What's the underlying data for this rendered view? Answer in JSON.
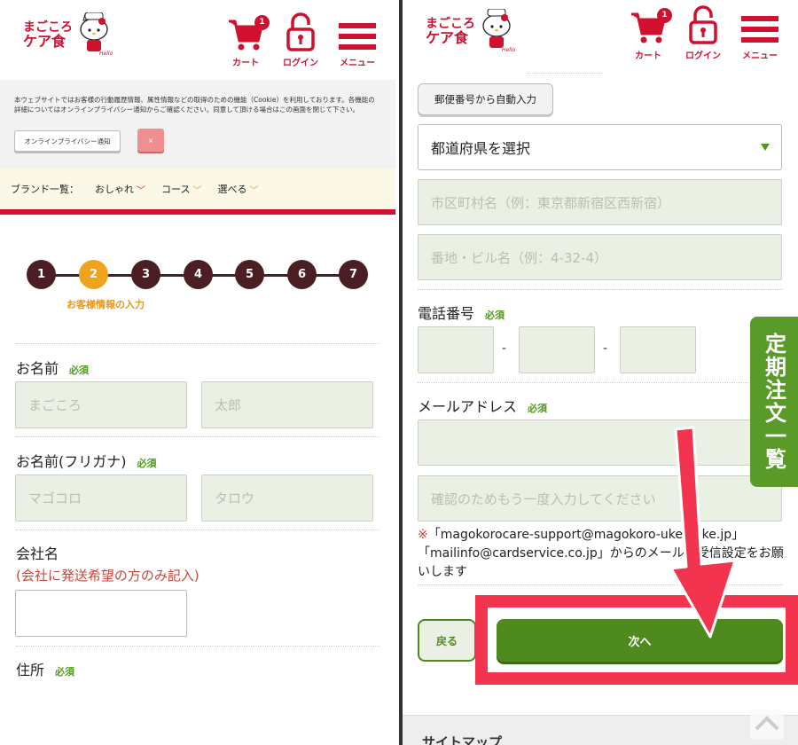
{
  "header": {
    "logo_line1": "まごころ",
    "logo_line2": "ケア食",
    "cart_label": "カート",
    "cart_count": "1",
    "login_label": "ログイン",
    "menu_label": "メニュー"
  },
  "cookie": {
    "text": "本ウェブサイトではお客様の行動履歴情報、属性情報などの取得のための機能（Cookie）を利用しております。各機能の詳細についてはオンラインプライバシー通知からご確認ください。同意して頂ける場合はこの画面を閉じて下さい。",
    "notice_button": "オンラインプライバシー通知",
    "close_button": "×"
  },
  "brand_nav": {
    "label": "ブランド一覧：",
    "items": [
      "おしゃれ",
      "コース",
      "選べる"
    ]
  },
  "steps": {
    "numbers": [
      "1",
      "2",
      "3",
      "4",
      "5",
      "6",
      "7"
    ],
    "active_index": 1,
    "caption": "お客様情報の入力"
  },
  "form_left": {
    "name_label": "お名前",
    "name_required": "必須",
    "last_name_placeholder": "まごころ",
    "first_name_placeholder": "太郎",
    "kana_label": "お名前(フリガナ)",
    "kana_required": "必須",
    "last_kana_placeholder": "マゴコロ",
    "first_kana_placeholder": "タロウ",
    "company_label": "会社名",
    "company_note": "(会社に発送希望の方のみ記入)",
    "address_label": "住所",
    "address_required": "必須"
  },
  "form_right": {
    "zip_button": "郵便番号から自動入力",
    "prefecture_select": "都道府県を選択",
    "city_placeholder": "市区町村名（例：東京都新宿区西新宿）",
    "street_placeholder": "番地・ビル名（例：4-32-4）",
    "phone_label": "電話番号",
    "phone_required": "必須",
    "phone_dash": "-",
    "email_label": "メールアドレス",
    "email_required": "必須",
    "email_confirm_placeholder": "確認のためもう一度入力してください",
    "mail_note_mark": "※",
    "mail_note": "「magokorocare-support@magokoro-uketsuke.jp」「mailinfo@cardservice.co.jp」からのメールの受信設定をお願いします",
    "back_button": "戻る",
    "next_button": "次へ",
    "sitemap": "サイトマップ",
    "side_tab": "定期注文一覧"
  },
  "colors": {
    "brand_red": "#d0102f",
    "step_brown": "#4a1e22",
    "step_active": "#f0a41c",
    "green": "#4f8a1f",
    "highlight": "#f2344f"
  }
}
